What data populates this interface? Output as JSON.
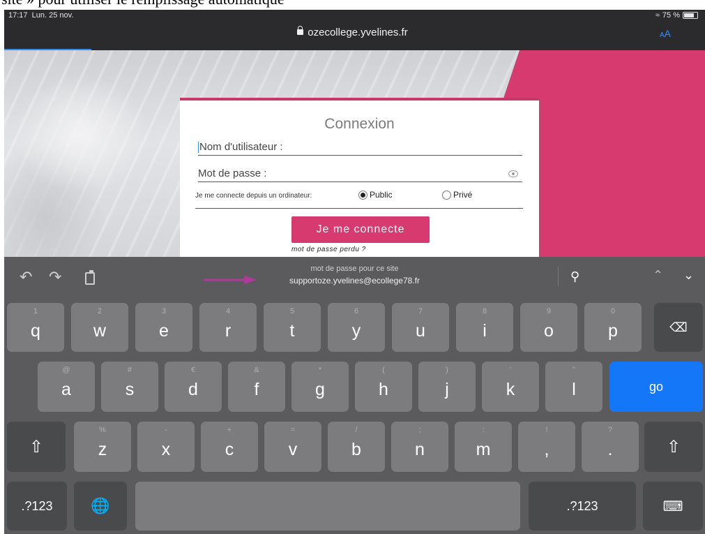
{
  "caption_text": "site » pour utiliser le remplissage automatique",
  "status": {
    "time": "17:17",
    "date": "Lun. 25 nov.",
    "battery": "75 %",
    "battery_level": 0.75
  },
  "browser": {
    "url": "ozecollege.yvelines.fr",
    "reader_button": "AA"
  },
  "login": {
    "title": "Connexion",
    "username_label": "Nom d'utilisateur :",
    "password_label": "Mot de passe :",
    "connect_from_label": "Je me connecte depuis un ordinateur:",
    "option_public": "Public",
    "option_private": "Privé",
    "selected_option": "Public",
    "submit_label": "Je me connecte",
    "forgot_label": "mot de passe perdu ?"
  },
  "keyboard": {
    "suggestion_title": "mot de passe pour ce site",
    "suggestion_value": "supportoze.yvelines@ecollege78.fr",
    "row1": [
      {
        "alt": "1",
        "key": "q"
      },
      {
        "alt": "2",
        "key": "w"
      },
      {
        "alt": "3",
        "key": "e"
      },
      {
        "alt": "4",
        "key": "r"
      },
      {
        "alt": "5",
        "key": "t"
      },
      {
        "alt": "6",
        "key": "y"
      },
      {
        "alt": "7",
        "key": "u"
      },
      {
        "alt": "8",
        "key": "i"
      },
      {
        "alt": "9",
        "key": "o"
      },
      {
        "alt": "0",
        "key": "p"
      }
    ],
    "row2": [
      {
        "alt": "@",
        "key": "a"
      },
      {
        "alt": "#",
        "key": "s"
      },
      {
        "alt": "€",
        "key": "d"
      },
      {
        "alt": "&",
        "key": "f"
      },
      {
        "alt": "*",
        "key": "g"
      },
      {
        "alt": "(",
        "key": "h"
      },
      {
        "alt": ")",
        "key": "j"
      },
      {
        "alt": "'",
        "key": "k"
      },
      {
        "alt": "\"",
        "key": "l"
      }
    ],
    "row3": [
      {
        "alt": "%",
        "key": "z"
      },
      {
        "alt": "-",
        "key": "x"
      },
      {
        "alt": "+",
        "key": "c"
      },
      {
        "alt": "=",
        "key": "v"
      },
      {
        "alt": "/",
        "key": "b"
      },
      {
        "alt": ";",
        "key": "n"
      },
      {
        "alt": ":",
        "key": "m"
      },
      {
        "alt": "!",
        "key": ","
      },
      {
        "alt": "?",
        "key": "."
      }
    ],
    "go_label": "go",
    "numbers_label": ".?123",
    "icons": {
      "undo": "undo-icon",
      "redo": "redo-icon",
      "paste": "paste-icon",
      "delete": "delete-icon",
      "shift": "shift-icon",
      "globe": "globe-icon",
      "hide_keyboard": "keyboard-hide-icon",
      "key": "key-icon"
    }
  },
  "colors": {
    "accent_pink": "#d63a6f",
    "go_blue": "#1477f8",
    "link_blue": "#3b8cff"
  }
}
